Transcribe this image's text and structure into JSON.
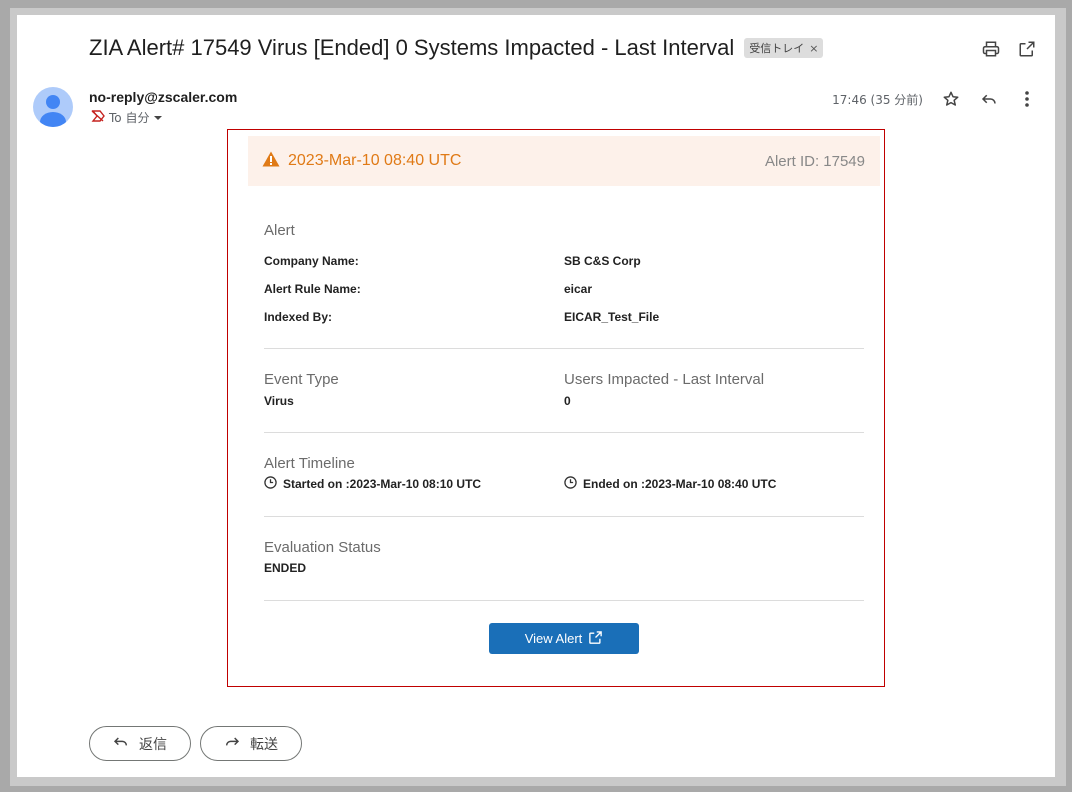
{
  "email": {
    "subject": "ZIA Alert# 17549 Virus [Ended] 0 Systems Impacted - Last Interval",
    "label": "受信トレイ",
    "label_close": "×",
    "sender": "no-reply@zscaler.com",
    "to_text": "To 自分",
    "time": "17:46 (35 分前)"
  },
  "alert": {
    "banner_time": "2023-Mar-10 08:40 UTC",
    "banner_id": "Alert ID: 17549",
    "section_alert": "Alert",
    "company_label": "Company Name:",
    "company_value": "SB C&S Corp",
    "rule_label": "Alert Rule Name:",
    "rule_value": "eicar",
    "indexed_label": "Indexed By:",
    "indexed_value": "EICAR_Test_File",
    "event_type_title": "Event Type",
    "event_type_value": "Virus",
    "users_title": "Users Impacted - Last Interval",
    "users_value": "0",
    "timeline_title": "Alert Timeline",
    "started": "Started on :2023-Mar-10 08:10 UTC",
    "ended": "Ended on :2023-Mar-10 08:40 UTC",
    "eval_title": "Evaluation Status",
    "eval_value": "ENDED",
    "view_button": "View Alert"
  },
  "actions": {
    "reply": "返信",
    "forward": "転送"
  },
  "colors": {
    "accent": "#e07a16",
    "button": "#1a6fb8",
    "border": "#c00000"
  }
}
